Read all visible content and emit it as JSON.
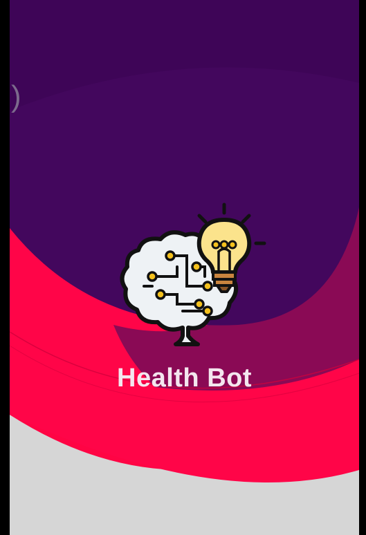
{
  "app": {
    "title": "Health Bot",
    "logo_icon": "brain-lightbulb-icon",
    "edge_glyph": ")"
  },
  "colors": {
    "purple": "#42075c",
    "crimson": "#ff0044",
    "wine": "#8b0a55",
    "light_gray": "#d9d9d9",
    "title_text": "#f4e6ee",
    "bulb_yellow": "#fbe28a",
    "circuit_gold": "#f2b90c"
  }
}
